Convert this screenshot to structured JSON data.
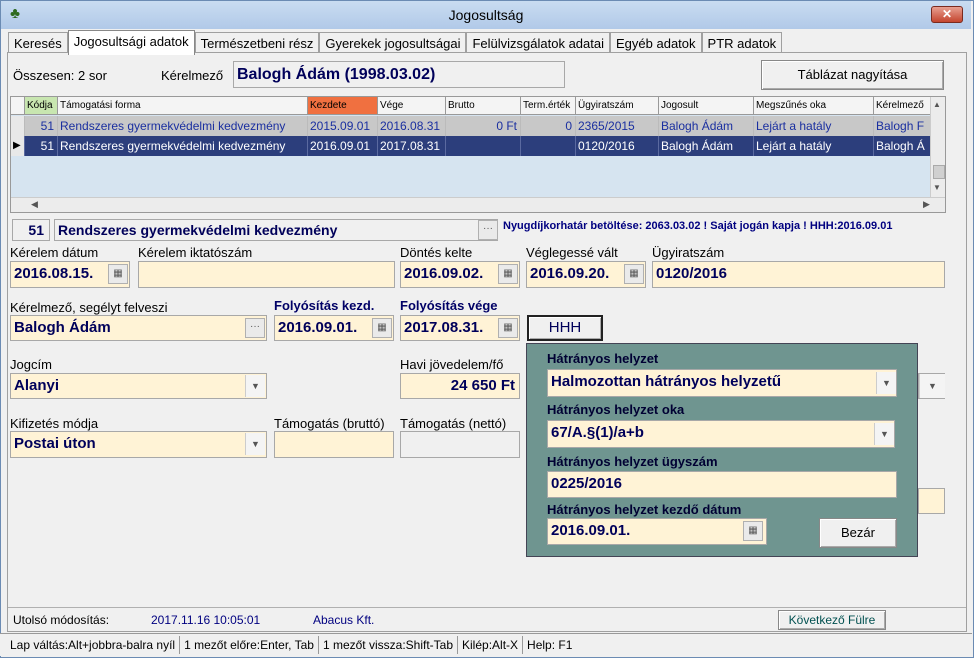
{
  "window": {
    "title": "Jogosultság"
  },
  "tabs": [
    {
      "label": "Keresés"
    },
    {
      "label": "Jogosultsági adatok"
    },
    {
      "label": "Természetbeni rész"
    },
    {
      "label": "Gyerekek jogosultságai"
    },
    {
      "label": "Felülvizsgálatok adatai"
    },
    {
      "label": "Egyéb adatok"
    },
    {
      "label": "PTR adatok"
    }
  ],
  "header": {
    "count_text": "Összesen: 2 sor",
    "applicant_label": "Kérelmező",
    "applicant_value": "Balogh Ádám (1998.03.02)",
    "enlarge_button": "Táblázat nagyítása"
  },
  "grid": {
    "columns": [
      "Kódja",
      "Támogatási forma",
      "Kezdete",
      "Vége",
      "Brutto",
      "Term.érték",
      "Ügyiratszám",
      "Jogosult",
      "Megszűnés oka",
      "Kérelmező"
    ],
    "rows": [
      [
        "51",
        "Rendszeres gyermekvédelmi kedvezmény",
        "2015.09.01",
        "2016.08.31",
        "0 Ft",
        "0",
        "2365/2015",
        "Balogh Ádám",
        "Lejárt a hatály",
        "Balogh F"
      ],
      [
        "51",
        "Rendszeres gyermekvédelmi kedvezmény",
        "2016.09.01",
        "2017.08.31",
        "",
        "",
        "0120/2016",
        "Balogh Ádám",
        "Lejárt a hatály",
        "Balogh Á"
      ]
    ]
  },
  "form": {
    "code": "51",
    "support_type": "Rendszeres gyermekvédelmi kedvezmény",
    "info_line": "Nyugdíjkorhatár betöltése: 2063.03.02  ! Saját jogán kapja ! HHH:2016.09.01",
    "request_date_label": "Kérelem dátum",
    "request_date": "2016.08.15.",
    "request_regno_label": "Kérelem iktatószám",
    "request_regno": "",
    "decision_label": "Döntés kelte",
    "decision_date": "2016.09.02.",
    "final_label": "Véglegessé vált",
    "final_date": "2016.09.20.",
    "caseno_label": "Ügyiratszám",
    "caseno": "0120/2016",
    "recipient_label": "Kérelmező, segélyt felveszi",
    "recipient": "Balogh Ádám",
    "pay_start_label": "Folyósítás kezd.",
    "pay_start": "2016.09.01.",
    "pay_end_label": "Folyósítás vége",
    "pay_end": "2017.08.31.",
    "hhh_button": "HHH",
    "title_label": "Jogcím",
    "title_value": "Alanyi",
    "income_label": "Havi jövedelem/fő",
    "income_value": "24 650 Ft",
    "payment_label": "Kifizetés módja",
    "payment_value": "Postai úton",
    "gross_label": "Támogatás (bruttó)",
    "net_label": "Támogatás (nettó)"
  },
  "popup": {
    "status_label": "Hátrányos helyzet",
    "status_value": "Halmozottan hátrányos helyzetű",
    "reason_label": "Hátrányos helyzet oka",
    "reason_value": "67/A.§(1)/a+b",
    "caseno_label": "Hátrányos helyzet ügyszám",
    "caseno_value": "0225/2016",
    "start_label": "Hátrányos helyzet kezdő dátum",
    "start_value": "2016.09.01.",
    "close_button": "Bezár"
  },
  "footer": {
    "modified_label": "Utolsó módosítás:",
    "modified_value": "2017.11.16 10:05:01",
    "modified_by": "Abacus Kft.",
    "next_tab_button": "Következő Fülre"
  },
  "statusbar": [
    "Lap váltás:Alt+jobbra-balra nyíl",
    "1 mezőt előre:Enter, Tab",
    "1 mezőt vissza:Shift-Tab",
    "Kilép:Alt-X",
    "Help: F1"
  ],
  "colors": {
    "field_bg": "#fff3d6",
    "selected_row": "#2c3e7c",
    "popup_bg": "#6f9590",
    "highlight_header": "#f07040"
  }
}
